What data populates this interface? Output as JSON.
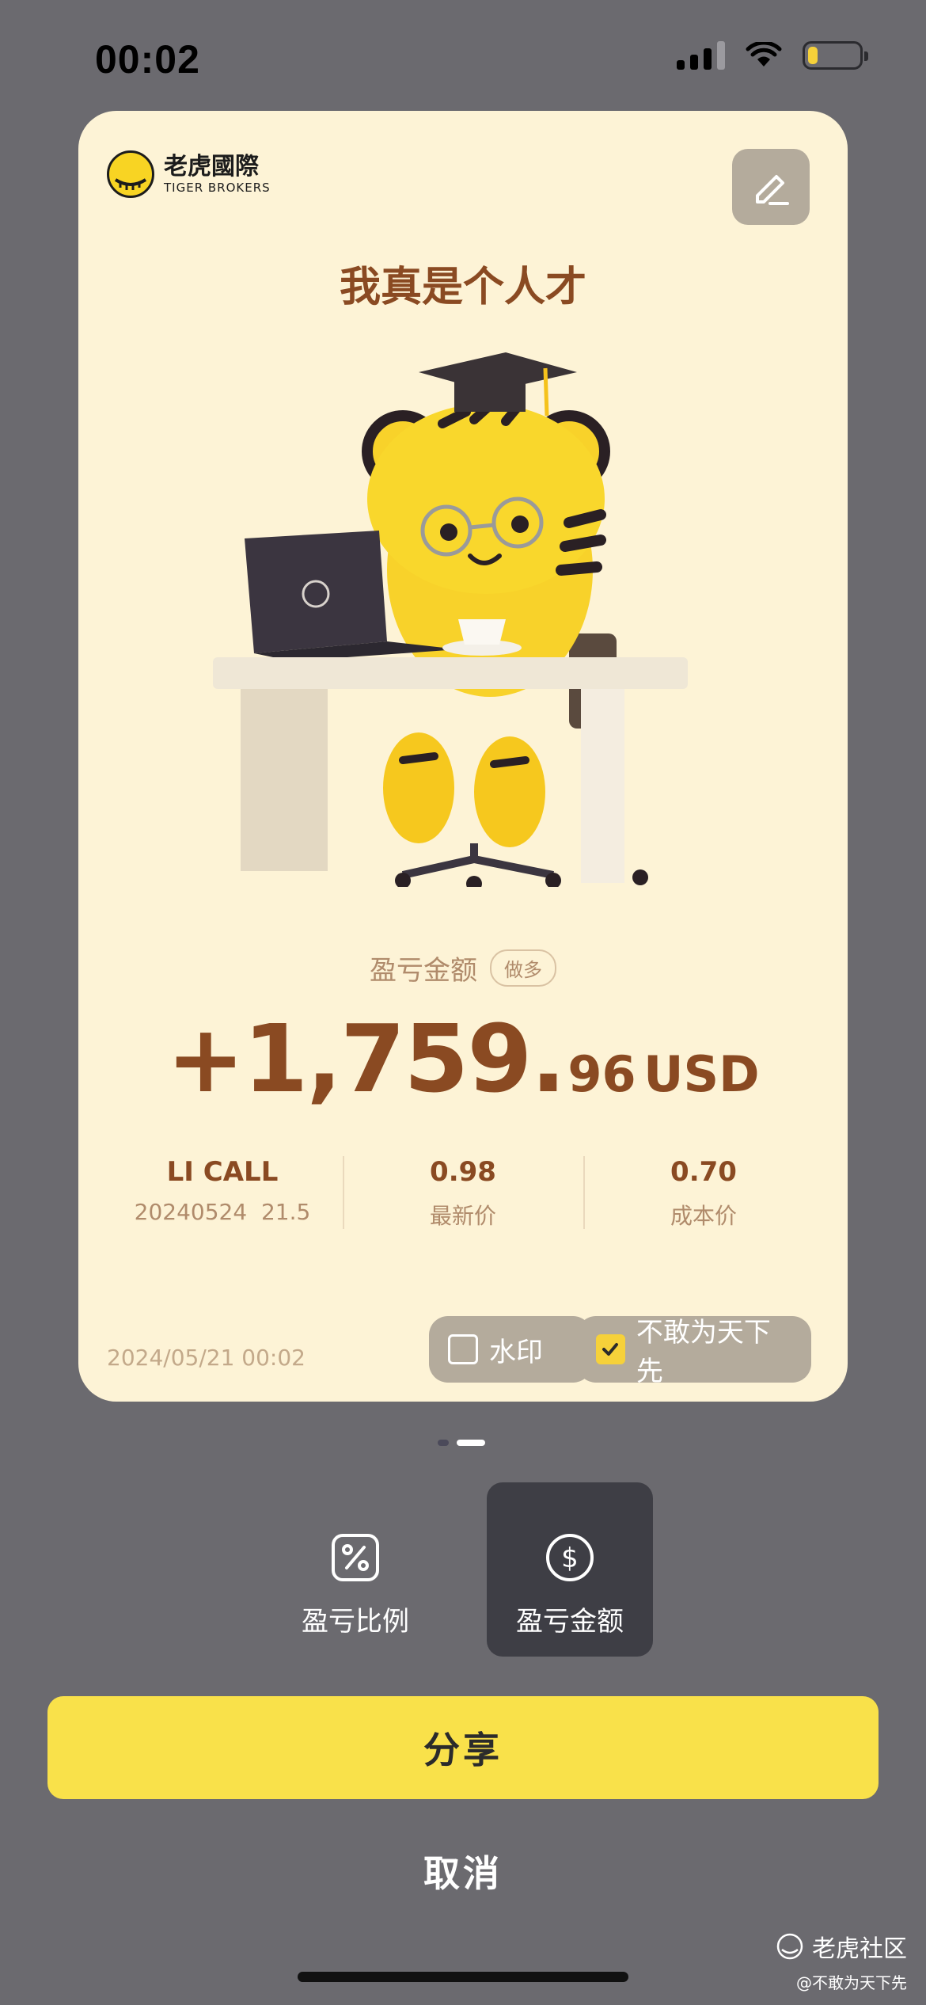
{
  "status_bar": {
    "time": "00:02",
    "battery_level": 0.2
  },
  "card": {
    "brand_cn": "老虎國際",
    "brand_en": "TIGER BROKERS",
    "headline": "我真是个人才",
    "pnl_label": "盈亏金额",
    "position_tag": "做多",
    "amount_main": "+1,759.",
    "amount_decimals": "96",
    "currency": "USD",
    "stats": [
      {
        "top": "LI CALL",
        "bottom": "20240524  21.5"
      },
      {
        "top": "0.98",
        "bottom": "最新价"
      },
      {
        "top": "0.70",
        "bottom": "成本价"
      }
    ],
    "date": "2024/05/21 00:02",
    "toggles": {
      "watermark_label": "水印",
      "watermark_checked": false,
      "nickname_label": "不敢为天下先",
      "nickname_checked": true
    }
  },
  "pagination": {
    "count": 2,
    "active": 1
  },
  "modes": {
    "ratio_label": "盈亏比例",
    "amount_label": "盈亏金额",
    "selected": "amount"
  },
  "buttons": {
    "share_label": "分享",
    "cancel_label": "取消"
  },
  "watermark": {
    "community": "老虎社区",
    "user": "@不敢为天下先"
  },
  "colors": {
    "card_bg": "#fdf3d6",
    "accent_brown": "#8a4a22",
    "share_yellow": "#f9e14a",
    "overlay_bg": "#6b6a6f"
  }
}
